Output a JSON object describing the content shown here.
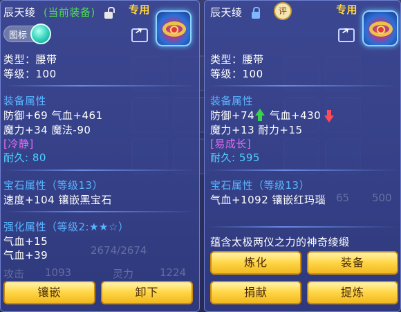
{
  "left": {
    "title": "辰天绫",
    "status": "(当前装备)",
    "exclusive": "专用",
    "icon_toggle": "图标",
    "type": "类型：腰带",
    "level": "等级：100",
    "attr_header": "装备属性",
    "attr_line1": "防御+69 气血+461",
    "attr_line2": "魔力+34 魔法-90",
    "special": "[冷静]",
    "durability_label": "耐久: ",
    "durability_value": "80",
    "gem_header": "宝石属性（等级13）",
    "gem_line": "速度+104 镶嵌黑宝石",
    "enhance_header": "强化属性（等级2:★★☆）",
    "enhance_line1": "气血+15",
    "enhance_line2": "气血+39",
    "buttons": {
      "inlay": "镶嵌",
      "unequip": "卸下"
    },
    "bg_text": {
      "stat1": "攻击",
      "stat1_val": "1093",
      "stat2": "灵力",
      "stat2_val": "1224",
      "hp": "2674/2674"
    }
  },
  "right": {
    "title": "辰天绫",
    "badge": "评",
    "exclusive": "专用",
    "type": "类型：腰带",
    "level": "等级：100",
    "attr_header": "装备属性",
    "attr_def": "防御+74",
    "attr_hp": "气血+430",
    "attr_line2": "魔力+13 耐力+15",
    "special": "[易成长]",
    "durability_label": "耐久: ",
    "durability_value": "595",
    "gem_header": "宝石属性（等级13）",
    "gem_line": "气血+1092 镶嵌红玛瑙",
    "description": "蕴含太极两仪之力的神奇绫缎",
    "buttons": {
      "refine": "炼化",
      "equip": "装备",
      "donate": "捐献",
      "extract": "提炼"
    },
    "bg_text": {
      "n1": "65",
      "n2": "500"
    }
  },
  "colors": {
    "accent_gold": "#ffd53a",
    "section_blue": "#59b4ff",
    "special_purple": "#e26bf3",
    "durability_cyan": "#4fd2ff",
    "equipped_green": "#4ee04a"
  },
  "icons": [
    "lock-open-icon",
    "lock-closed-icon",
    "share-icon",
    "belt-item-icon",
    "up-arrow-icon",
    "down-arrow-icon",
    "rating-badge-icon"
  ]
}
